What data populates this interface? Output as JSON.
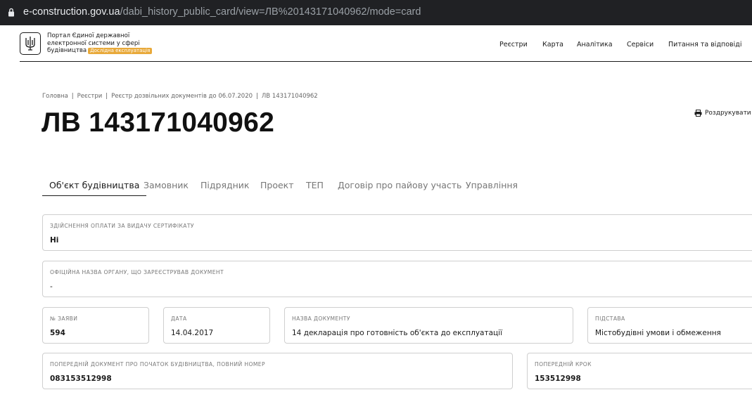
{
  "browser": {
    "url_host": "e-construction.gov.ua",
    "url_path": "/dabi_history_public_card/view=ЛВ%20143171040962/mode=card"
  },
  "header": {
    "portal_line1": "Портал Єдиної державної",
    "portal_line2": "електронної системи у сфері",
    "portal_line3": "будівництва",
    "badge": "Дослідна експлуатація",
    "nav": [
      "Реєстри",
      "Карта",
      "Аналітика",
      "Сервіси",
      "Питання та відповіді"
    ]
  },
  "breadcrumb": [
    "Головна",
    "Реєстри",
    "Реєстр дозвільних документів до 06.07.2020",
    "ЛВ 143171040962"
  ],
  "page_title": "ЛВ 143171040962",
  "print_label": "Роздрукувати",
  "tabs": [
    "Об'єкт будівництва",
    "Замовник",
    "Підрядник",
    "Проект",
    "ТЕП",
    "Договір про пайову участь",
    "Управління"
  ],
  "fields": {
    "payment": {
      "label": "Здійснення оплати за видачу сертифікату",
      "value": "Ні"
    },
    "authority": {
      "label": "Офіційна назва органу, що зареєстрував документ",
      "value": "-"
    },
    "application_no": {
      "label": "№ заяви",
      "value": "594"
    },
    "date": {
      "label": "Дата",
      "value": "14.04.2017"
    },
    "doc_name": {
      "label": "Назва документу",
      "value": "14 декларація про готовність об'єкта до експлуатації"
    },
    "basis": {
      "label": "Підстава",
      "value": "Містобудівні умови і обмеження"
    },
    "prev_doc": {
      "label": "Попередній документ про початок будівництва, повний номер",
      "value": "083153512998"
    },
    "prev_step": {
      "label": "Попередній крок",
      "value": "153512998"
    }
  },
  "colors": {
    "badge": "#e8a93a",
    "browser_bar": "#202124"
  }
}
